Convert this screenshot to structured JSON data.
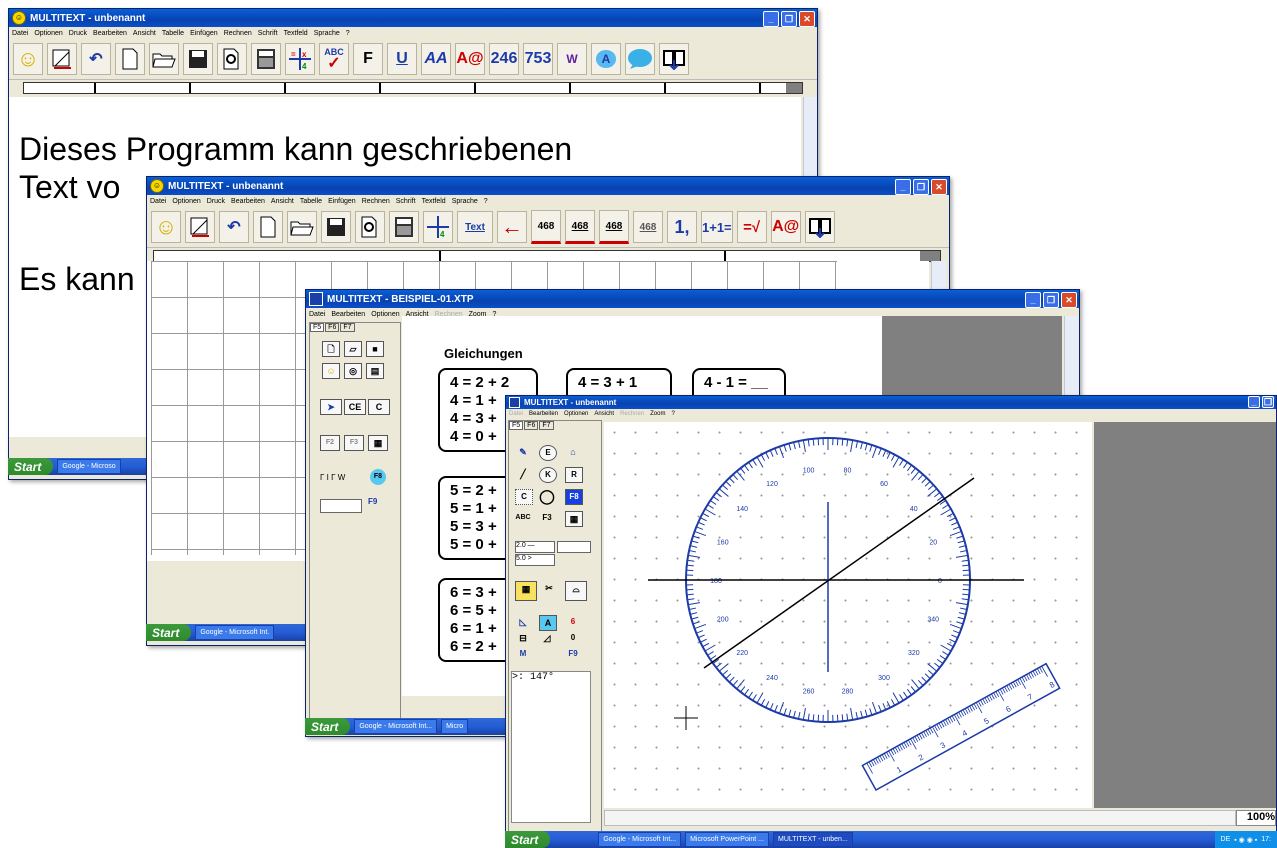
{
  "window1": {
    "title": "MULTITEXT - unbenannt",
    "menu": [
      "Datei",
      "Optionen",
      "Druck",
      "Bearbeiten",
      "Ansicht",
      "Tabelle",
      "Einfügen",
      "Rechnen",
      "Schrift",
      "Textfeld",
      "Sprache",
      "?"
    ],
    "toolbar": [
      "smiley-icon",
      "ruler-triangle-icon",
      "undo-icon",
      "new-doc-icon",
      "open-folder-icon",
      "save-icon",
      "print-preview-icon",
      "calculator-icon",
      "math-grid-icon",
      "spellcheck-icon",
      "F",
      "U",
      "AA",
      "A@",
      "246",
      "753",
      "W",
      "A",
      "speech-bubble-icon",
      "book-icon"
    ],
    "toolbar_text": {
      "spell": "ABC",
      "bold": "F",
      "underline": "U",
      "aa": "AA",
      "ac": "A@",
      "n246": "246",
      "n753": "753",
      "w": "W",
      "a": "A"
    },
    "text_line1": "Dieses Programm kann geschriebenen",
    "text_line2": "Text vo",
    "text_line3": "Es kann"
  },
  "window2": {
    "title": "MULTITEXT - unbenannt",
    "menu": [
      "Datei",
      "Optionen",
      "Druck",
      "Bearbeiten",
      "Ansicht",
      "Tabelle",
      "Einfügen",
      "Rechnen",
      "Schrift",
      "Textfeld",
      "Sprache",
      "?"
    ],
    "toolbar_text": {
      "text": "Text",
      "n468a": "468",
      "n468b": "468",
      "n468c": "468",
      "n468d": "468",
      "one": "1,",
      "oneplus": "1+1=",
      "eqroot": "=√",
      "ac": "A@"
    }
  },
  "window3": {
    "title": "MULTITEXT - BEISPIEL-01.XTP",
    "menu": [
      "Datei",
      "Bearbeiten",
      "Optionen",
      "Ansicht",
      "Rechnen",
      "Zoom",
      "?"
    ],
    "menu_disabled": [
      "Rechnen"
    ],
    "tabs": [
      "F5",
      "F6",
      "F7"
    ],
    "side": {
      "ce": "CE",
      "c": "C",
      "f2": "F2",
      "f3": "F3",
      "check": "Γ I Γ W",
      "f8": "F8",
      "f9": "F9"
    },
    "heading": "Gleichungen",
    "box1": [
      "4 = 2 + 2",
      "4 = 1 +",
      "4 = 3 +",
      "4 = 0 +"
    ],
    "box2": "4 = 3 + 1",
    "box3": "4 - 1 = __",
    "box4": [
      "5 = 2 +",
      "5 = 1 +",
      "5 = 3 +",
      "5 = 0 +"
    ],
    "box5": [
      "6 = 3 +",
      "6 = 5 +",
      "6 = 1 +",
      "6 = 2 +"
    ]
  },
  "window4": {
    "title": "MULTITEXT - unbenannt",
    "menu": [
      "Datei",
      "Bearbeiten",
      "Optionen",
      "Ansicht",
      "Rechnen",
      "Zoom",
      "?"
    ],
    "menu_disabled": [
      "Datei",
      "Rechnen"
    ],
    "tabs": [
      "F5",
      "F6",
      "F7"
    ],
    "side": {
      "e": "E",
      "k": "K",
      "r": "R",
      "c": "C",
      "f8": "F8",
      "abc": "ABC",
      "f3": "F3",
      "s1": "2.0 —",
      "s2": "5.0 >",
      "n6": "6",
      "m": "M",
      "n0": "0",
      "f9": "F9"
    },
    "readout": ">: 147°",
    "protractor_labels": [
      "100",
      "80",
      "120",
      "60",
      "140",
      "40",
      "160",
      "20",
      "180",
      "0",
      "200",
      "340",
      "220",
      "320",
      "240",
      "300",
      "260",
      "280"
    ],
    "ruler_labels": [
      "1",
      "2",
      "3",
      "4",
      "5",
      "6",
      "7",
      "8"
    ],
    "zoom": "100%"
  },
  "taskbars": {
    "start": "Start",
    "t1": [
      "Google - Microso"
    ],
    "t2": [
      "Google - Microsoft Int."
    ],
    "t3": [
      "Google - Microsoft Int...",
      "Micro"
    ],
    "t4": [
      "Google - Microsoft Int...",
      "Microsoft PowerPoint ...",
      "MULTITEXT - unben..."
    ],
    "tray": "DE",
    "clock": "17:"
  }
}
